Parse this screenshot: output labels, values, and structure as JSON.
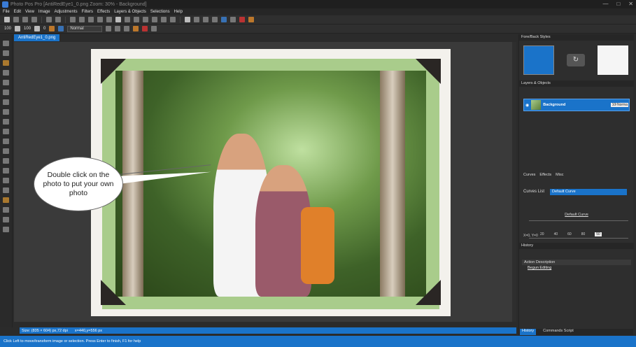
{
  "window": {
    "title": "Photo Pos Pro [AntiRedEye1_0.png Zoom: 30% - Background]"
  },
  "menu": [
    "File",
    "Edit",
    "View",
    "Image",
    "Adjustments",
    "Filters",
    "Effects",
    "Layers & Objects",
    "Selections",
    "Help"
  ],
  "toolbar2": {
    "size": "100",
    "opacity": "100",
    "value3": "0",
    "blend_mode": "Normal"
  },
  "document_tab": "AntiRedEye1_0.png",
  "canvas": {
    "callout_text": "Double click on the photo to put your own photo",
    "colors": {
      "frame": "#a9cc8b",
      "page": "#f3f1ec"
    }
  },
  "status": {
    "size": "Size: (835 × 604) px,72 dpi",
    "coords": "x=440,y=556 px",
    "hint": "Click Left to move/transform image or selection. Press Enter to finish, F1 for help"
  },
  "right_panel": {
    "fore_back_title": "Fore/Back Styles",
    "fore_color": "#1a73c9",
    "back_color": "#f5f5f5",
    "layers_title": "Layers & Objects",
    "layer": {
      "name": "Background",
      "opacity": "100",
      "mode": "Norma"
    },
    "tabs": [
      "Curves",
      "Effects",
      "Misc"
    ],
    "curves_list_label": "Curves List",
    "curve_selected": "Default Curve",
    "curve_name": "Default Curve",
    "curve_ticks": [
      "20",
      "40",
      "60",
      "80"
    ],
    "curve_xy": "X=0, Y=0",
    "curve_value": "50",
    "history_title": "History",
    "history_header": "Action Description",
    "history_item": "Begun Editing",
    "bottom_tabs": [
      "History",
      "Commands Script"
    ]
  }
}
